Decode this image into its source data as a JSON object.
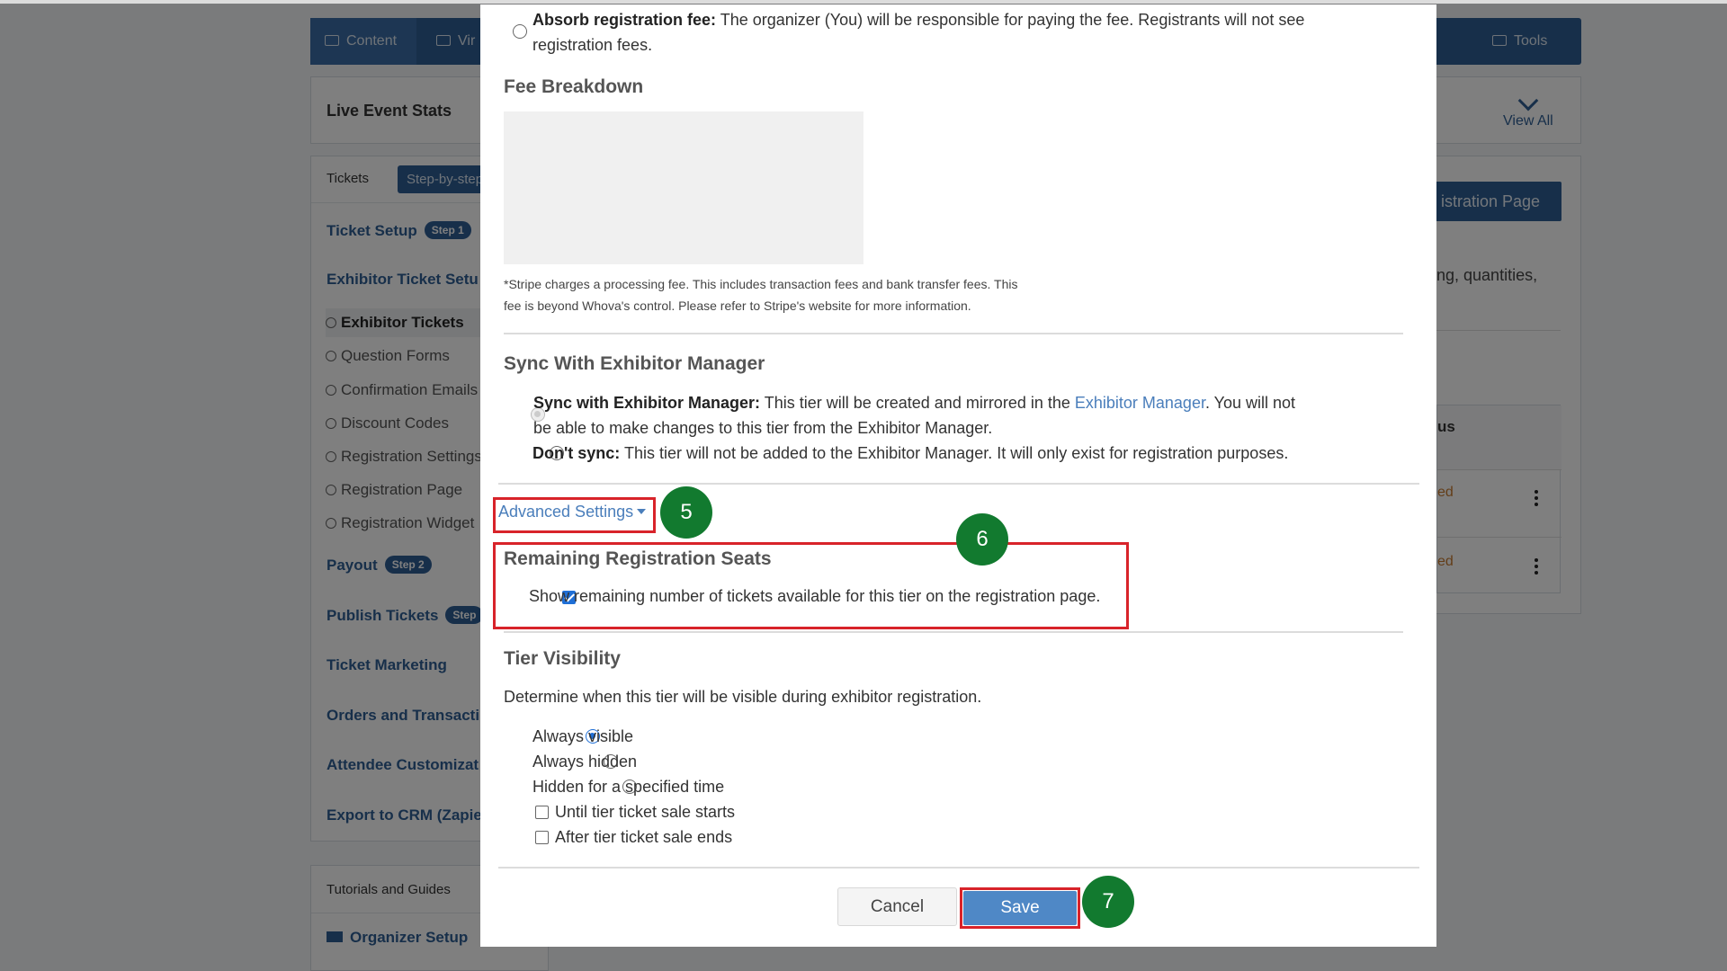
{
  "background": {
    "nav_tabs": [
      {
        "label": "Content"
      },
      {
        "label": "Vir"
      },
      {
        "label": "Tools"
      }
    ],
    "live_event_stats": "Live Event Stats",
    "view_all": "View All",
    "sidebar": {
      "tab_tickets": "Tickets",
      "tab_step_by_step": "Step-by-step",
      "ticket_setup": "Ticket Setup",
      "ticket_setup_step": "Step 1",
      "exhibitor_ticket_setup": "Exhibitor Ticket Setu",
      "sub_items": [
        {
          "label": "Exhibitor Tickets"
        },
        {
          "label": "Question Forms"
        },
        {
          "label": "Confirmation Emails"
        },
        {
          "label": "Discount Codes"
        },
        {
          "label": "Registration Settings"
        },
        {
          "label": "Registration Page"
        },
        {
          "label": "Registration Widget"
        }
      ],
      "payout": "Payout",
      "payout_step": "Step 2",
      "publish_tickets": "Publish Tickets",
      "publish_step": "Step",
      "ticket_marketing": "Ticket Marketing",
      "orders": "Orders and Transacti",
      "attendee_custom": "Attendee Customizat",
      "export_crm": "Export to CRM (Zapie",
      "tutorials": "Tutorials and Guides",
      "organizer_setup": "Organizer Setup"
    },
    "registration_page_btn": "istration Page",
    "right_text": "ng, quantities,",
    "status_header": "us",
    "status_row1": "ed",
    "status_row2": "ed"
  },
  "modal": {
    "absorb_label": "Absorb registration fee:",
    "absorb_text": " The organizer (You) will be responsible for paying the fee. Registrants will not see",
    "absorb_text2": "registration fees.",
    "fee_breakdown_title": "Fee Breakdown",
    "stripe_note_1": "*Stripe charges a processing fee. This includes transaction fees and bank transfer fees. This",
    "stripe_note_2": "fee is beyond Whova's control. Please refer to Stripe's website for more information.",
    "sync_title": "Sync With Exhibitor Manager",
    "sync_label": "Sync with Exhibitor Manager:",
    "sync_text_a": " This tier will be created and mirrored in the ",
    "sync_link": "Exhibitor Manager",
    "sync_text_b": ". You will not",
    "sync_text_2": "be able to make changes to this tier from the Exhibitor Manager.",
    "dont_sync_label": "Don't sync:",
    "dont_sync_text": " This tier will not be added to the Exhibitor Manager. It will only exist for registration purposes.",
    "advanced_settings": "Advanced Settings",
    "remaining_title": "Remaining Registration Seats",
    "remaining_checkbox": "Show remaining number of tickets available for this tier on the registration page.",
    "tier_visibility_title": "Tier Visibility",
    "tier_visibility_desc": "Determine when this tier will be visible during exhibitor registration.",
    "visibility_options": [
      {
        "label": "Always visible",
        "checked": true
      },
      {
        "label": "Always hidden",
        "checked": false
      },
      {
        "label": "Hidden for a specified time",
        "checked": false
      }
    ],
    "hidden_sub_options": [
      {
        "label": "Until tier ticket sale starts"
      },
      {
        "label": "After tier ticket sale ends"
      }
    ],
    "cancel": "Cancel",
    "save": "Save"
  },
  "markers": {
    "m5": "5",
    "m6": "6",
    "m7": "7"
  },
  "colors": {
    "nav_blue": "#2f5f95",
    "link_blue": "#4a7ebb",
    "highlight_red": "#d8232a",
    "marker_green": "#127a2f",
    "save_blue": "#4f88c6"
  }
}
